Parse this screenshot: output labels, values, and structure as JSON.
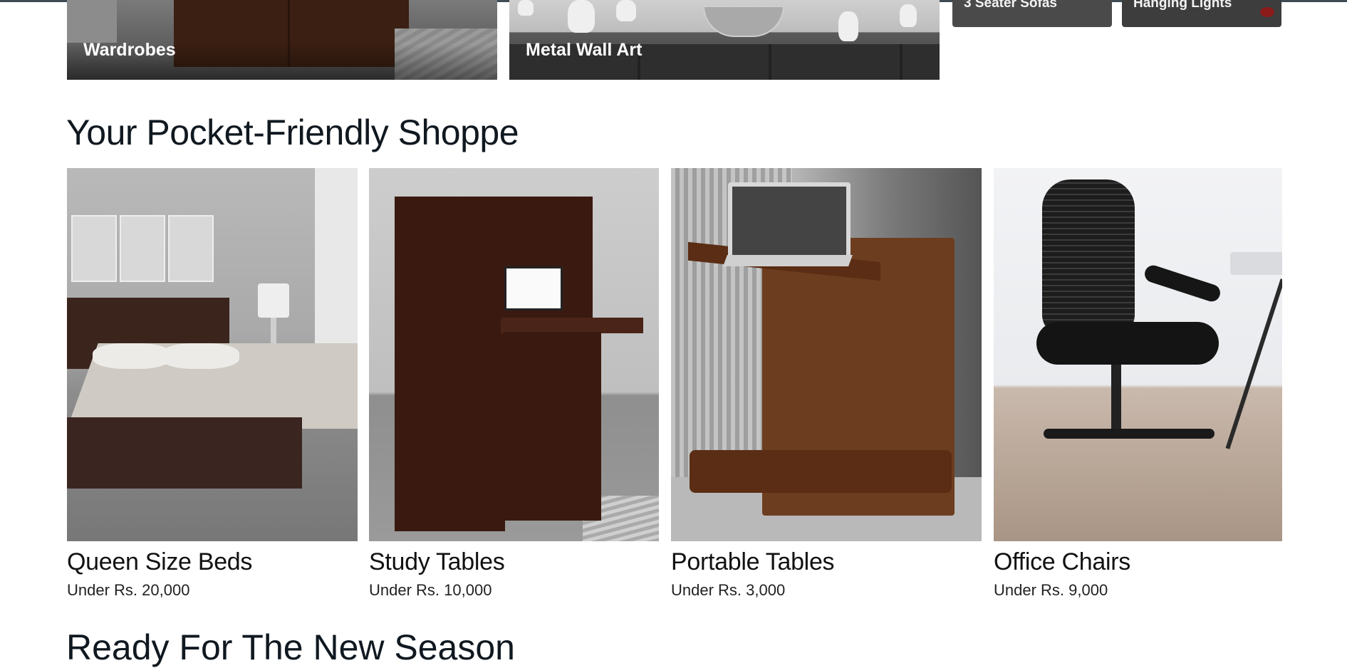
{
  "top_tiles": [
    {
      "label": "Wardrobes"
    },
    {
      "label": "Metal Wall Art"
    },
    {
      "label": "3 Seater Sofas"
    },
    {
      "label": "Hanging Lights"
    }
  ],
  "section": {
    "title": "Your Pocket-Friendly Shoppe",
    "cards": [
      {
        "name": "Queen Size Beds",
        "price": "Under Rs. 20,000"
      },
      {
        "name": "Study Tables",
        "price": "Under Rs. 10,000"
      },
      {
        "name": "Portable Tables",
        "price": "Under Rs. 3,000"
      },
      {
        "name": "Office Chairs",
        "price": "Under Rs. 9,000"
      }
    ]
  },
  "next_section": {
    "title": "Ready For The New Season"
  }
}
